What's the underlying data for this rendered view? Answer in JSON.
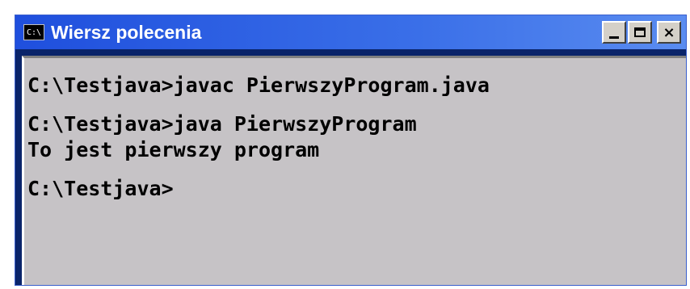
{
  "window": {
    "title": "Wiersz polecenia",
    "icon_text": "C:\\",
    "controls": {
      "minimize": "minimize-icon",
      "maximize": "maximize-icon",
      "close": "×"
    }
  },
  "console": {
    "lines": [
      "C:\\Testjava>javac PierwszyProgram.java",
      "C:\\Testjava>java PierwszyProgram",
      "To jest pierwszy program",
      "C:\\Testjava>"
    ]
  },
  "colors": {
    "titlebar": "#1f4fdd",
    "console_bg": "#c6c3c6",
    "text": "#000000"
  }
}
